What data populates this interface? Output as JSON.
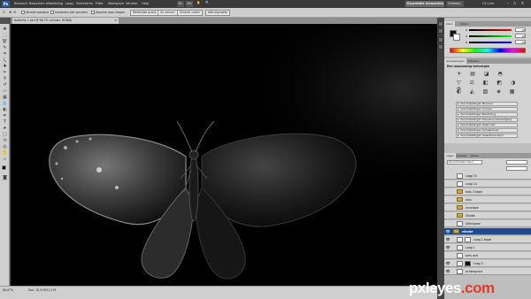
{
  "app": {
    "logo": "Ps",
    "menus": [
      "Bestand",
      "Bewerken",
      "Afbeelding",
      "Laag",
      "Selecteren",
      "Filter",
      "Weergave",
      "Venster",
      "Help"
    ],
    "workspaces": [
      "Essentiële elementen",
      "Ontwerp"
    ],
    "cs_live": "CS Live"
  },
  "options": {
    "checkbox1": "Venster passend",
    "checkbox2": "Inzoomen alle vensters",
    "checkbox3": "Zoomen door slepen",
    "button1": "Werkelijke pixels",
    "button2": "Zo vensen",
    "button3": "Scherm vullen",
    "button4": "Afdrukgrootte"
  },
  "document": {
    "tab_title": "butterfly 1.psd @ 66,7% (vlinder, RGB/8)"
  },
  "status": {
    "zoom": "66,67%",
    "doc_info": "Doc: 10,9 M/51,3 M"
  },
  "panels": {
    "color_tabs": [
      "Kleur",
      "Stalen"
    ],
    "color_sliders": [
      {
        "label": "R",
        "value": "18"
      },
      {
        "label": "G",
        "value": "18"
      },
      {
        "label": "B",
        "value": "18"
      }
    ],
    "adjust_tabs": [
      "Aanpassingen",
      "Maskers"
    ],
    "adjust_title": "Een aanpassing toevoegen",
    "presets": [
      "Voorinstellingen Niveaus",
      "Voorinstellingen Curven",
      "Voorinstellingen Belichting",
      "Voorinstellingen Kleurtoon/verzadiging",
      "Voorinstellingen Zwart-wit",
      "Voorinstellingen Kanaalmixer",
      "Voorinstellingen Selectieve kleur"
    ],
    "layers_tabs": [
      "Lagen",
      "Kanalen",
      "Paden"
    ],
    "blend_mode": "Doordrukken kleur",
    "layers": [
      {
        "name": "Laag 15",
        "type": "layer",
        "thumb": "white",
        "selected": false
      },
      {
        "name": "Laag 14",
        "type": "layer",
        "thumb": "white",
        "selected": false
      },
      {
        "name": "roos 3 kopie",
        "type": "folder",
        "selected": false
      },
      {
        "name": "roos",
        "type": "folder",
        "selected": false
      },
      {
        "name": "envelope",
        "type": "folder",
        "selected": false
      },
      {
        "name": "Vlinder",
        "type": "folder",
        "selected": false
      },
      {
        "name": "Uitknippen",
        "type": "layer",
        "thumb": "white",
        "selected": false
      },
      {
        "name": "vlinder",
        "type": "folder",
        "selected": true
      },
      {
        "name": "Laag 2 kopie",
        "type": "layer",
        "thumb": "white",
        "selected": false
      },
      {
        "name": "Laag 1",
        "type": "layer",
        "thumb": "white",
        "selected": false
      },
      {
        "name": "pers and",
        "type": "layer",
        "thumb": "white",
        "selected": false
      },
      {
        "name": "Laag 3",
        "type": "layer",
        "thumb": "black",
        "selected": false
      },
      {
        "name": "achtergrond",
        "type": "layer",
        "thumb": "white",
        "selected": false
      }
    ]
  },
  "watermark": {
    "text": "pxleyes",
    "suffix": ".com"
  },
  "colors": {
    "canvas": "#000000",
    "selected_layer": "#1f4b8e",
    "brand_accent": "#e23b2a"
  }
}
